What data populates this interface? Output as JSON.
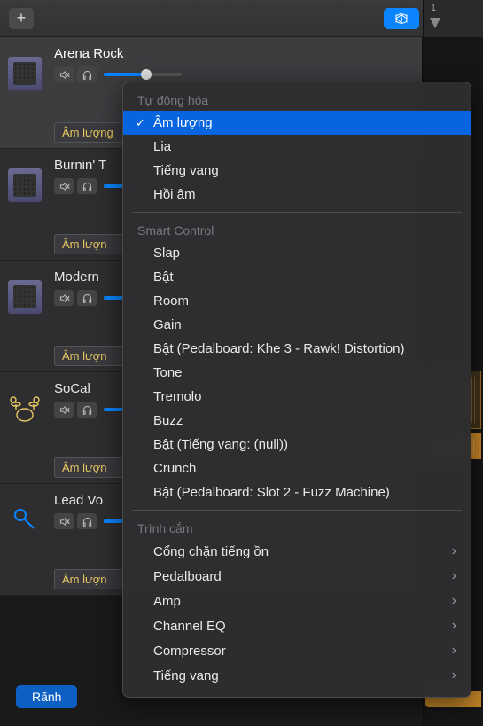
{
  "toolbar": {
    "add_icon": "plus",
    "loop_icon": "cycle",
    "ruler_start": "1"
  },
  "tracks": [
    {
      "name": "Arena Rock",
      "icon": "amp",
      "auto_label": "Âm lượng",
      "selected": true
    },
    {
      "name": "Burnin' T",
      "icon": "amp",
      "auto_label": "Âm lượn",
      "selected": false
    },
    {
      "name": "Modern",
      "icon": "amp",
      "auto_label": "Âm lượn",
      "selected": false
    },
    {
      "name": "SoCal",
      "icon": "drum",
      "auto_label": "Âm lượn",
      "selected": false
    },
    {
      "name": "Lead Vo",
      "icon": "mic",
      "auto_label": "Âm lượn",
      "selected": false
    }
  ],
  "bottom_button": "Rãnh",
  "popup": {
    "sections": [
      {
        "title": "Tự động hóa",
        "items": [
          {
            "label": "Âm lượng",
            "selected": true
          },
          {
            "label": "Lia"
          },
          {
            "label": "Tiếng vang"
          },
          {
            "label": "Hồi âm"
          }
        ]
      },
      {
        "title": "Smart Control",
        "items": [
          {
            "label": "Slap"
          },
          {
            "label": "Bật"
          },
          {
            "label": "Room"
          },
          {
            "label": "Gain"
          },
          {
            "label": "Bật (Pedalboard: Khe 3 - Rawk! Distortion)"
          },
          {
            "label": "Tone"
          },
          {
            "label": "Tremolo"
          },
          {
            "label": "Buzz"
          },
          {
            "label": "Bật (Tiếng vang: (null))"
          },
          {
            "label": "Crunch"
          },
          {
            "label": "Bật (Pedalboard: Slot 2 - Fuzz Machine)"
          }
        ]
      },
      {
        "title": "Trình cắm",
        "items": [
          {
            "label": "Cổng chặn tiếng ồn",
            "submenu": true
          },
          {
            "label": "Pedalboard",
            "submenu": true
          },
          {
            "label": "Amp",
            "submenu": true
          },
          {
            "label": "Channel EQ",
            "submenu": true
          },
          {
            "label": "Compressor",
            "submenu": true
          },
          {
            "label": "Tiếng vang",
            "submenu": true
          }
        ]
      }
    ]
  }
}
